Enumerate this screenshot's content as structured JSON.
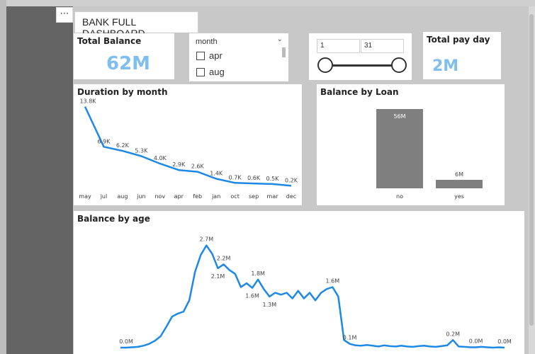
{
  "report": {
    "menu_label": "⋯",
    "title": "BANK FULL DASHBOARD"
  },
  "kpis": {
    "total_balance": {
      "title": "Total Balance",
      "value": "62M"
    },
    "total_pay_day": {
      "title": "Total pay day",
      "value": "2M"
    }
  },
  "month_slicer": {
    "header": "month",
    "options": [
      "apr",
      "aug"
    ]
  },
  "day_slider": {
    "min_value": "1",
    "max_value": "31"
  },
  "colors": {
    "accent": "#1e88e5",
    "kpi_value": "#7fbfef",
    "bar": "#7f7f7f"
  },
  "chart_data": [
    {
      "type": "line",
      "title": "Duration by month",
      "categories": [
        "may",
        "jul",
        "aug",
        "jun",
        "nov",
        "apr",
        "feb",
        "jan",
        "oct",
        "sep",
        "mar",
        "dec"
      ],
      "values": [
        13800,
        6900,
        6200,
        5300,
        4000,
        2900,
        2600,
        1400,
        700,
        600,
        500,
        200
      ],
      "data_labels": [
        "13.8K",
        "6.9K",
        "6.2K",
        "5.3K",
        "4.0K",
        "2.9K",
        "2.6K",
        "1.4K",
        "0.7K",
        "0.6K",
        "0.5K",
        "0.2K"
      ],
      "ylim": [
        0,
        14000
      ],
      "grid": false
    },
    {
      "type": "bar",
      "title": "Balance by Loan",
      "categories": [
        "no",
        "yes"
      ],
      "values": [
        56,
        6
      ],
      "data_labels": [
        "56M",
        "6M"
      ],
      "ylim": [
        0,
        56
      ],
      "grid": false
    },
    {
      "type": "line",
      "title": "Balance by age",
      "values": [
        0.0,
        0.0,
        0.01,
        0.02,
        0.05,
        0.1,
        0.18,
        0.3,
        0.55,
        0.82,
        0.9,
        0.95,
        1.25,
        2.0,
        2.45,
        2.7,
        2.48,
        2.1,
        2.2,
        2.05,
        1.95,
        1.6,
        1.7,
        1.58,
        1.8,
        1.55,
        1.35,
        1.45,
        1.4,
        1.45,
        1.3,
        1.5,
        1.3,
        1.45,
        1.25,
        1.45,
        1.55,
        1.6,
        1.35,
        0.2,
        0.1,
        0.06,
        0.05,
        0.07,
        0.05,
        0.03,
        0.06,
        0.04,
        0.03,
        0.05,
        0.03,
        0.02,
        0.04,
        0.05,
        0.03,
        0.02,
        0.04,
        0.06,
        0.2,
        0.03,
        0.02,
        0.01,
        0.01,
        0.02,
        0.01,
        0.0,
        0.01,
        0.0
      ],
      "data_labels": [
        {
          "index": 1,
          "text": "0.0M"
        },
        {
          "index": 15,
          "text": "2.7M"
        },
        {
          "index": 17,
          "text": "2.1M"
        },
        {
          "index": 18,
          "text": "2.2M"
        },
        {
          "index": 23,
          "text": "1.6M"
        },
        {
          "index": 24,
          "text": "1.8M"
        },
        {
          "index": 26,
          "text": "1.3M"
        },
        {
          "index": 37,
          "text": "1.6M"
        },
        {
          "index": 40,
          "text": "0.1M"
        },
        {
          "index": 58,
          "text": "0.2M"
        },
        {
          "index": 62,
          "text": "0.0M"
        },
        {
          "index": 67,
          "text": "0.0M"
        }
      ],
      "ylim": [
        0,
        2.9
      ],
      "grid": false
    }
  ]
}
